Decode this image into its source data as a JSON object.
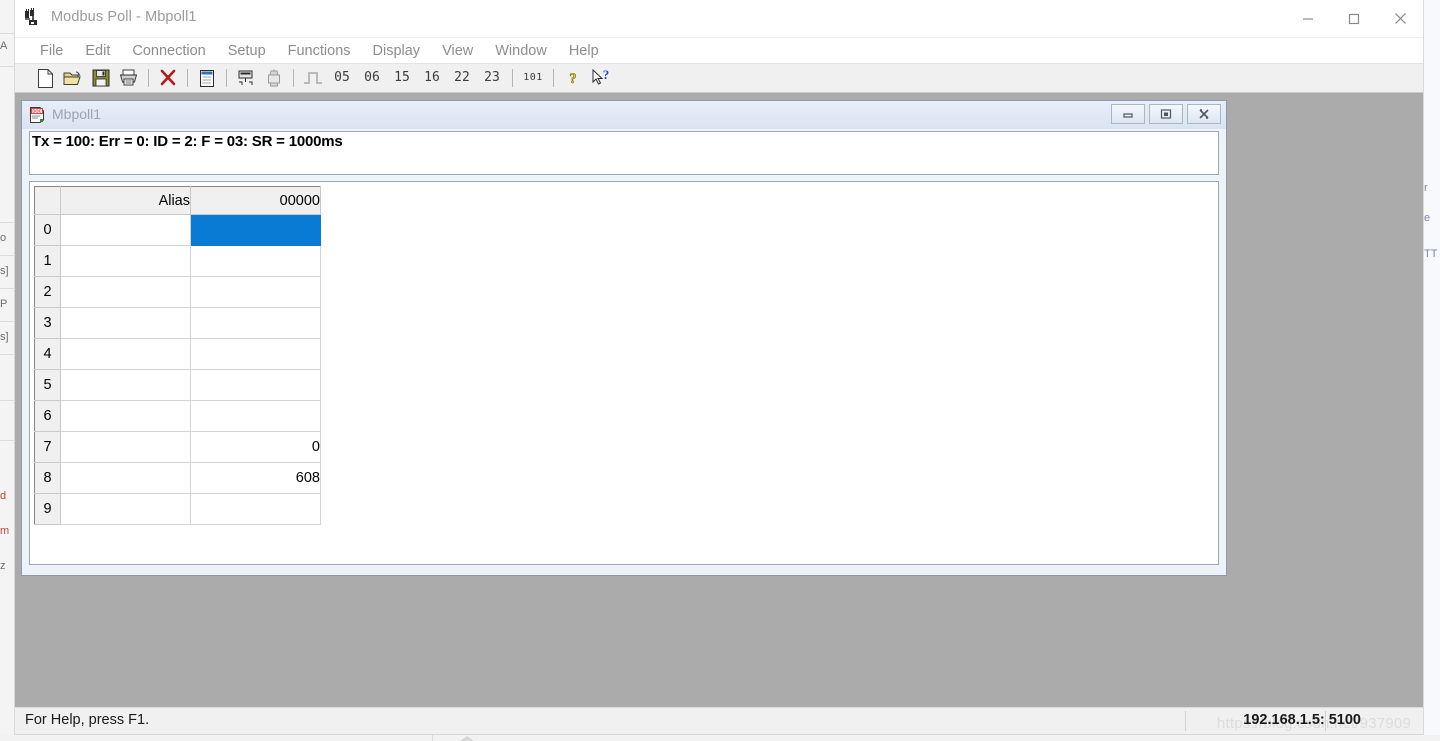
{
  "window": {
    "title": "Modbus Poll - Mbpoll1",
    "app_icon": "modbus-app-icon",
    "controls": {
      "minimize": "minimize-icon",
      "maximize": "maximize-icon",
      "close": "close-icon"
    }
  },
  "menubar": {
    "items": [
      {
        "label": "File"
      },
      {
        "label": "Edit"
      },
      {
        "label": "Connection"
      },
      {
        "label": "Setup"
      },
      {
        "label": "Functions"
      },
      {
        "label": "Display"
      },
      {
        "label": "View"
      },
      {
        "label": "Window"
      },
      {
        "label": "Help"
      }
    ]
  },
  "toolbar": {
    "items": [
      {
        "kind": "icon",
        "name": "new-file-icon",
        "label": ""
      },
      {
        "kind": "icon",
        "name": "open-folder-icon",
        "label": ""
      },
      {
        "kind": "icon",
        "name": "save-icon",
        "label": ""
      },
      {
        "kind": "icon",
        "name": "print-icon",
        "label": ""
      },
      {
        "kind": "sep",
        "name": "toolbar-separator-1",
        "label": ""
      },
      {
        "kind": "icon",
        "name": "disconnect-icon",
        "label": ""
      },
      {
        "kind": "sep",
        "name": "toolbar-separator-2",
        "label": ""
      },
      {
        "kind": "icon",
        "name": "read-write-definition-icon",
        "label": ""
      },
      {
        "kind": "sep",
        "name": "toolbar-separator-3",
        "label": ""
      },
      {
        "kind": "icon",
        "name": "poll-definition-icon",
        "label": ""
      },
      {
        "kind": "icon",
        "name": "print-preview-icon",
        "label": ""
      },
      {
        "kind": "sep",
        "name": "toolbar-separator-4",
        "label": ""
      },
      {
        "kind": "icon",
        "name": "pulse-signal-icon",
        "label": ""
      },
      {
        "kind": "num",
        "name": "function-05-button",
        "label": "05"
      },
      {
        "kind": "num",
        "name": "function-06-button",
        "label": "06"
      },
      {
        "kind": "num",
        "name": "function-15-button",
        "label": "15"
      },
      {
        "kind": "num",
        "name": "function-16-button",
        "label": "16"
      },
      {
        "kind": "num",
        "name": "function-22-button",
        "label": "22"
      },
      {
        "kind": "num",
        "name": "function-23-button",
        "label": "23"
      },
      {
        "kind": "sep",
        "name": "toolbar-separator-5",
        "label": ""
      },
      {
        "kind": "num-small",
        "name": "binary-101-button",
        "label": "101"
      },
      {
        "kind": "sep",
        "name": "toolbar-separator-6",
        "label": ""
      },
      {
        "kind": "icon",
        "name": "help-question-icon",
        "label": ""
      },
      {
        "kind": "icon",
        "name": "context-help-icon",
        "label": ""
      }
    ]
  },
  "mdi_child": {
    "title": "Mbpoll1",
    "icon": "document-doc-icon",
    "status_line": "Tx = 100: Err = 0: ID = 2: F = 03: SR = 1000ms",
    "controls": {
      "minimize": "mdi-minimize-icon",
      "restore": "mdi-restore-icon",
      "close": "mdi-close-icon"
    },
    "grid": {
      "headers": [
        "",
        "Alias",
        "00000"
      ],
      "rows": [
        {
          "index": "0",
          "alias": "",
          "value": "",
          "selected": true
        },
        {
          "index": "1",
          "alias": "",
          "value": "",
          "selected": false
        },
        {
          "index": "2",
          "alias": "",
          "value": "",
          "selected": false
        },
        {
          "index": "3",
          "alias": "",
          "value": "",
          "selected": false
        },
        {
          "index": "4",
          "alias": "",
          "value": "",
          "selected": false
        },
        {
          "index": "5",
          "alias": "",
          "value": "",
          "selected": false
        },
        {
          "index": "6",
          "alias": "",
          "value": "",
          "selected": false
        },
        {
          "index": "7",
          "alias": "",
          "value": "0",
          "selected": false
        },
        {
          "index": "8",
          "alias": "",
          "value": "608",
          "selected": false
        },
        {
          "index": "9",
          "alias": "",
          "value": "",
          "selected": false
        }
      ]
    }
  },
  "statusbar": {
    "help_text": "For Help, press F1.",
    "connection": "192.168.1.5: 5100",
    "watermark": "https://blog.csdn.net/937909"
  },
  "background_windows": {
    "left_fragments": [
      "A",
      "o",
      "s]",
      "P",
      "s]",
      "d",
      "m",
      "z"
    ],
    "right_fragments": [
      "r",
      "e",
      "TT"
    ]
  },
  "colors": {
    "selection_blue": "#0a7bd4",
    "mdi_background": "#ababab",
    "titlebar": "#ffffff",
    "toolbar": "#f0f0f0",
    "mdi_title_gradient_top": "#e7eef8"
  }
}
